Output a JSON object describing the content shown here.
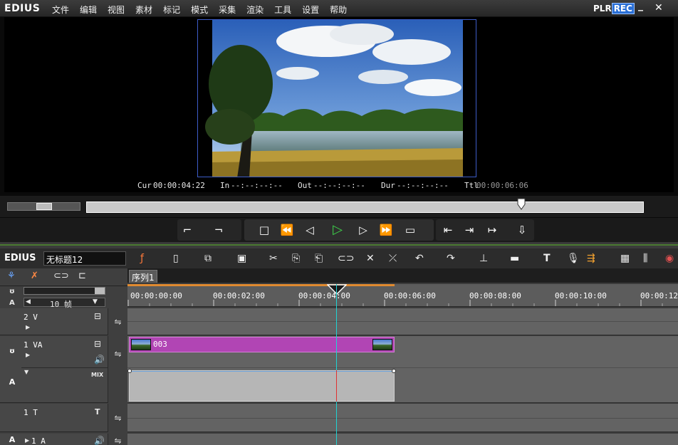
{
  "app": {
    "logo": "EDIUS",
    "menus": [
      "文件",
      "编辑",
      "视图",
      "素材",
      "标记",
      "模式",
      "采集",
      "渲染",
      "工具",
      "设置",
      "帮助"
    ],
    "mode_plr": "PLR",
    "mode_rec": "REC",
    "min_glyph": "_",
    "close_glyph": "✕"
  },
  "player": {
    "cur_label": "Cur",
    "cur_value": "00:00:04:22",
    "in_label": "In",
    "in_value": "--:--:--:--",
    "out_label": "Out",
    "out_value": "--:--:--:--",
    "dur_label": "Dur",
    "dur_value": "--:--:--:--",
    "ttl_label": "Ttl",
    "ttl_value": "00:00:06:06",
    "playhead_position": 0.78
  },
  "timeline": {
    "logo": "EDIUS",
    "project_name": "无标题12",
    "sequence_tab": "序列1",
    "zoom_label": "10 帧",
    "ruler_labels": [
      "00:00:00:00",
      "00:00:02:00",
      "00:00:04:00",
      "00:00:06:00",
      "00:00:08:00",
      "00:00:10:00",
      "00:00:12"
    ],
    "tracks": {
      "t2v": {
        "name": "2 V"
      },
      "t1va": {
        "name": "1 VA",
        "mix_label": "MIX",
        "side_label": "A"
      },
      "t1t": {
        "name": "1 T",
        "glyph": "T"
      },
      "t1a": {
        "name": "1 A",
        "side_label": "A"
      }
    },
    "clip_name": "003"
  },
  "colors": {
    "accent_blue": "#2a6fd6",
    "clip_video": "#b145b4",
    "clip_audio": "#b6b6b6",
    "timeline_cursor": "#1fd4d4",
    "play_green": "#3fd24a"
  }
}
